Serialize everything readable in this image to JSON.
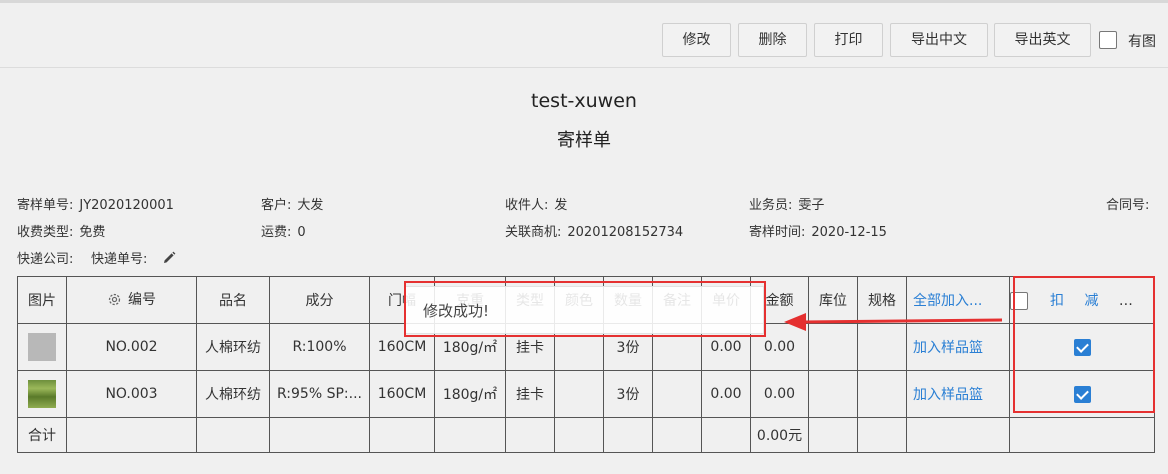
{
  "toolbar": {
    "buttons": [
      "修改",
      "删除",
      "打印",
      "导出中文",
      "导出英文"
    ],
    "checkbox_label": "有图"
  },
  "document": {
    "company": "test-xuwen",
    "title": "寄样单"
  },
  "info": {
    "sample_no_label": "寄样单号:",
    "sample_no": "JY2020120001",
    "customer_label": "客户:",
    "customer": "大发",
    "recipient_label": "收件人:",
    "recipient": "发",
    "salesperson_label": "业务员:",
    "salesperson": "雯子",
    "contract_label": "合同号:",
    "fee_type_label": "收费类型:",
    "fee_type": "免费",
    "freight_label": "运费:",
    "freight": "0",
    "opportunity_label": "关联商机:",
    "opportunity": "20201208152734",
    "send_time_label": "寄样时间:",
    "send_time": "2020-12-15",
    "courier_label": "快递公司:",
    "tracking_label": "快递单号:"
  },
  "table": {
    "headers": [
      "图片",
      "编号",
      "品名",
      "成分",
      "门幅",
      "克重",
      "类型",
      "颜色",
      "数量",
      "备注",
      "单价",
      "金额",
      "库位",
      "规格",
      "全部加入...",
      "扣 减 库 存"
    ],
    "rows": [
      {
        "code": "NO.002",
        "name": "人棉环纺",
        "composition": "R:100%",
        "width": "160CM",
        "weight": "180g/㎡",
        "type": "挂卡",
        "color": "",
        "qty": "3份",
        "remark": "",
        "price": "0.00",
        "amount": "0.00",
        "location": "",
        "spec": "",
        "action": "加入样品篮",
        "checked": true
      },
      {
        "code": "NO.003",
        "name": "人棉环纺",
        "composition": "R:95% SP:...",
        "width": "160CM",
        "weight": "180g/㎡",
        "type": "挂卡",
        "color": "",
        "qty": "3份",
        "remark": "",
        "price": "0.00",
        "amount": "0.00",
        "location": "",
        "spec": "",
        "action": "加入样品篮",
        "checked": true
      }
    ],
    "total_label": "合计",
    "total_amount": "0.00元"
  },
  "toast": {
    "message": "修改成功!"
  },
  "colors": {
    "accent": "#2a7fd4",
    "highlight": "#e53030"
  }
}
